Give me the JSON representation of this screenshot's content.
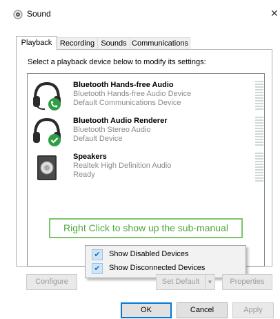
{
  "window": {
    "title": "Sound",
    "close_glyph": "✕"
  },
  "tabs": [
    {
      "label": "Playback",
      "active": true
    },
    {
      "label": "Recording"
    },
    {
      "label": "Sounds"
    },
    {
      "label": "Communications"
    }
  ],
  "playback": {
    "instruction": "Select a playback device below to modify its settings:",
    "devices": [
      {
        "name": "Bluetooth Hands-free Audio",
        "description": "Bluetooth Hands-free Audio Device",
        "status": "Default Communications Device",
        "icon": "headset-phone-icon",
        "badge_color": "#2e9e44"
      },
      {
        "name": "Bluetooth Audio Renderer",
        "description": "Bluetooth Stereo Audio",
        "status": "Default Device",
        "icon": "headset-check-icon",
        "badge_color": "#2e9e44"
      },
      {
        "name": "Speakers",
        "description": "Realtek High Definition Audio",
        "status": "Ready",
        "icon": "speaker-icon"
      }
    ]
  },
  "annotation": {
    "text": "Right Click to show up the sub-manual",
    "color": "#4ea63a"
  },
  "context_menu": {
    "items": [
      {
        "label": "Show Disabled Devices",
        "checked": true
      },
      {
        "label": "Show Disconnected Devices",
        "checked": true
      }
    ]
  },
  "buttons": {
    "configure": "Configure",
    "set_default": "Set Default",
    "properties": "Properties",
    "ok": "OK",
    "cancel": "Cancel",
    "apply": "Apply"
  },
  "colors": {
    "accent": "#0078d7",
    "meter": "#cfd8d2"
  }
}
